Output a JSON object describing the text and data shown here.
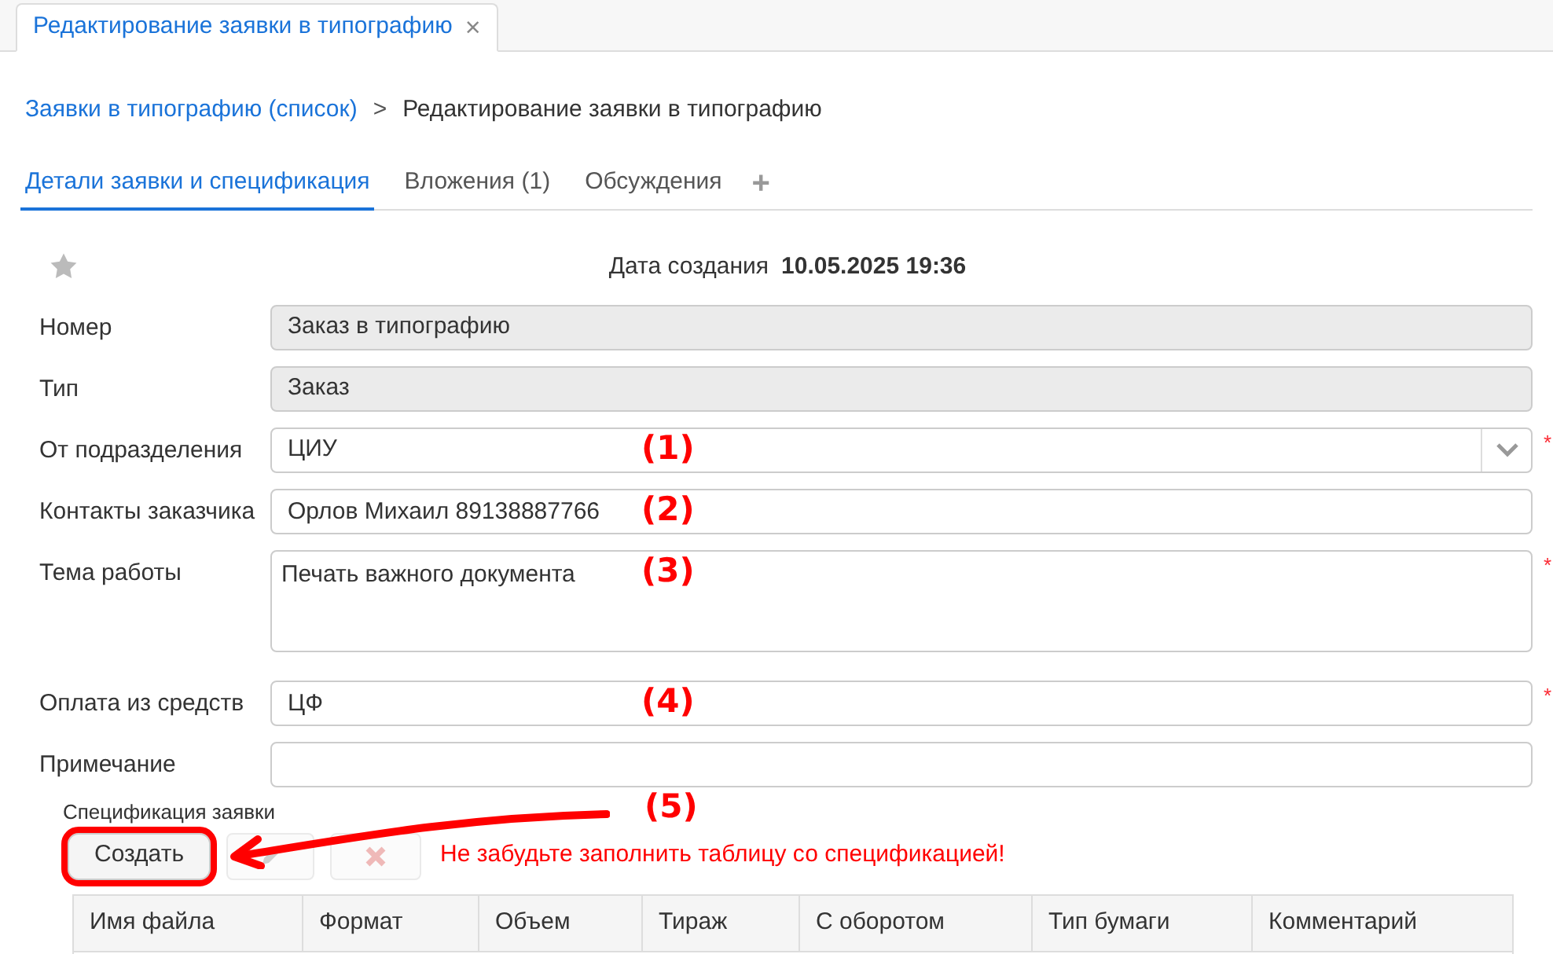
{
  "window_tab": {
    "title": "Редактирование заявки в типографию",
    "close": "×"
  },
  "breadcrumb": {
    "link": "Заявки в типографию (список)",
    "separator": ">",
    "current": "Редактирование заявки в типографию"
  },
  "tabs": [
    {
      "label": "Детали заявки и спецификация",
      "selected": true
    },
    {
      "label": "Вложения (1)",
      "selected": false
    },
    {
      "label": "Обсуждения",
      "selected": false
    }
  ],
  "add_tab": "+",
  "created": {
    "label": "Дата создания",
    "value": "10.05.2025 19:36"
  },
  "fields": [
    {
      "label": "Номер",
      "kind": "readonly",
      "value": "Заказ в типографию"
    },
    {
      "label": "Тип",
      "kind": "readonly",
      "value": "Заказ"
    },
    {
      "label": "От подразделения",
      "kind": "select",
      "value": "ЦИУ",
      "required_mark": "*",
      "annotation": "(1)"
    },
    {
      "label": "Контакты заказчика",
      "kind": "text",
      "value": "Орлов Михаил 89138887766",
      "annotation": "(2)"
    },
    {
      "label": "Тема работы",
      "kind": "textarea",
      "value": "Печать важного документа",
      "required_mark": "*",
      "annotation": "(3)"
    },
    {
      "label": "Оплата из средств",
      "kind": "text",
      "value": "ЦФ",
      "required_mark": "*",
      "annotation": "(4)"
    },
    {
      "label": "Примечание",
      "kind": "text"
    }
  ],
  "spec": {
    "title": "Спецификация заявки",
    "annotation": "(5)",
    "warning": "Не забудьте заполнить таблицу со спецификацией!",
    "buttons": [
      {
        "kind": "create",
        "label": "Создать",
        "disabled": false,
        "highlighted": true
      },
      {
        "kind": "edit",
        "disabled": true,
        "highlighted": false
      },
      {
        "kind": "delete",
        "disabled": true,
        "highlighted": false
      }
    ],
    "columns": [
      "Имя файла",
      "Формат",
      "Объем",
      "Тираж",
      "С оборотом",
      "Тип бумаги",
      "Комментарий"
    ]
  }
}
